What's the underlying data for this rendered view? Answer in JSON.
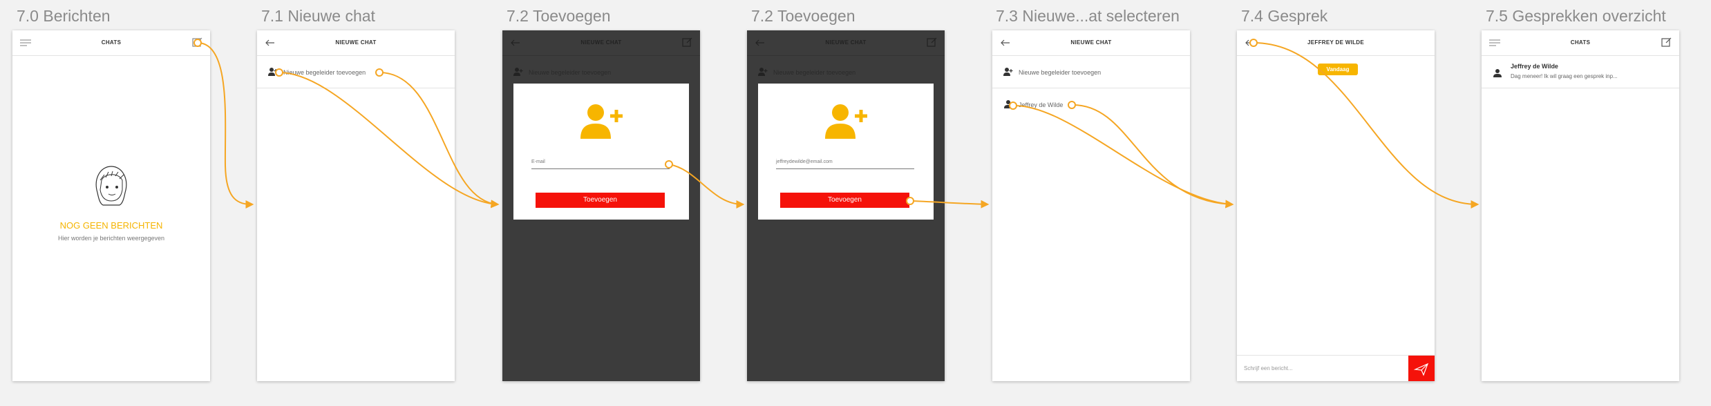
{
  "labels": [
    "7.0 Berichten",
    "7.1 Nieuwe chat",
    "7.2 Toevoegen",
    "7.2 Toevoegen",
    "7.3 Nieuwe...at selecteren",
    "7.4 Gesprek",
    "7.5 Gesprekken overzicht"
  ],
  "colors": {
    "accent": "#f5a623",
    "button_red": "#f5120a",
    "empty_yellow": "#f5b400",
    "badge": "#f7b500",
    "dark_overlay": "#3c3c3c"
  },
  "s0": {
    "title": "CHATS",
    "left_icon": "menu-icon",
    "right_icon": "compose-icon",
    "empty_title": "NOG GEEN BERICHTEN",
    "empty_sub": "Hier worden je berichten weergegeven"
  },
  "s1": {
    "title": "NIEUWE CHAT",
    "left_icon": "back-arrow-icon",
    "row_label": "Nieuwe begeleider toevoegen"
  },
  "s2": {
    "title": "NIEUWE CHAT",
    "row_label": "Nieuwe begeleider toevoegen",
    "field_placeholder": "E-mail",
    "button_label": "Toevoegen"
  },
  "s3": {
    "title": "NIEUWE CHAT",
    "row_label": "Nieuwe begeleider toevoegen",
    "field_value": "jeffreydewilde@email.com",
    "button_label": "Toevoegen"
  },
  "s4": {
    "title": "NIEUWE CHAT",
    "row_label": "Nieuwe begeleider toevoegen",
    "contact": "Jeffrey de Wilde"
  },
  "s5": {
    "title": "JEFFREY DE WILDE",
    "badge": "Vandaag",
    "input_placeholder": "Schrijf een bericht..."
  },
  "s6": {
    "title": "CHATS",
    "chat_name": "Jeffrey de Wilde",
    "chat_preview": "Dag meneer! Ik wil graag een gesprek inp..."
  }
}
